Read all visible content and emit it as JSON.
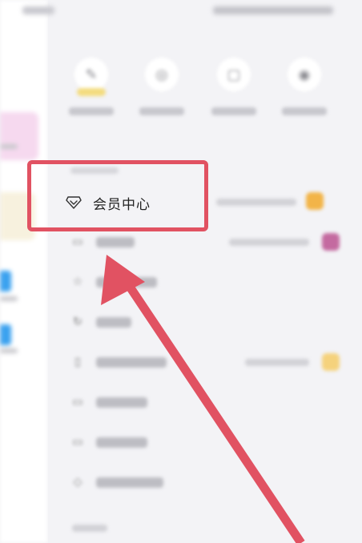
{
  "drawer": {
    "vip_item": {
      "label": "会员中心",
      "icon": "diamond-icon"
    },
    "quick_actions": [
      {
        "icon": "edit-icon",
        "highlighted": true
      },
      {
        "icon": "settings-circle-icon",
        "highlighted": false
      },
      {
        "icon": "calendar-icon",
        "highlighted": false
      },
      {
        "icon": "more-icon",
        "highlighted": false
      }
    ],
    "menu_icons": [
      "document-icon",
      "star-icon",
      "refresh-icon",
      "trash-icon",
      "tag-icon",
      "settings-icon",
      "help-icon"
    ]
  },
  "annotation": {
    "box_color": "#e15262",
    "arrow_color": "#e15262"
  }
}
